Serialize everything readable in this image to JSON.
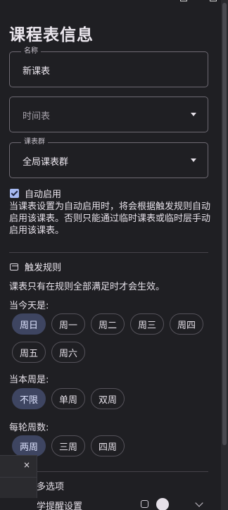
{
  "page_title": "课程表信息",
  "fields": {
    "name": {
      "label": "名称",
      "value": "新课表"
    },
    "timetable": {
      "placeholder": "时间表"
    },
    "group": {
      "label": "课表群",
      "value": "全局课表群"
    }
  },
  "auto_enable": {
    "label": "自动启用",
    "description": "当课表设置为自动启用时，将会根据触发规则自动启用该课表。否则只能通过临时课表或临时层手动启用该课表。"
  },
  "rules": {
    "title": "触发规则",
    "note": "课表只有在规则全部满足时才会生效。",
    "weekday_label": "当今天是:",
    "weekdays": [
      "周日",
      "周一",
      "周二",
      "周三",
      "周四",
      "周五",
      "周六"
    ],
    "week_parity_label": "当本周是:",
    "week_parity": [
      "不限",
      "单周",
      "双周"
    ],
    "cycle_label": "每轮周数:",
    "cycle": [
      "两周",
      "三周",
      "四周"
    ]
  },
  "more_options": {
    "label": "多选项"
  },
  "reminder": {
    "label": "学提醒设置"
  },
  "popup": {
    "close": "×"
  }
}
